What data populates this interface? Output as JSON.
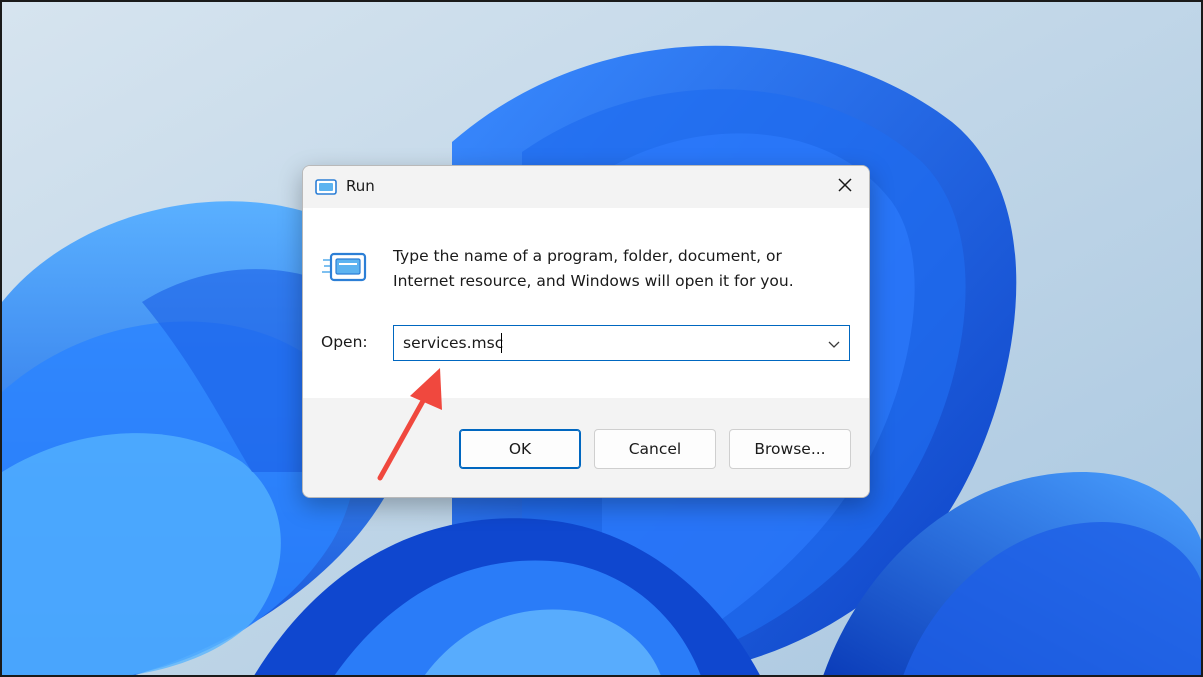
{
  "window": {
    "title": "Run",
    "title_icon": "run-icon",
    "close_icon": "close-icon"
  },
  "content": {
    "icon": "run-icon",
    "description_line1": "Type the name of a program, folder, document, or",
    "description_line2": "Internet resource, and Windows will open it for you.",
    "open_label": "Open:",
    "open_value": "services.msc",
    "dropdown_icon": "chevron-down-icon"
  },
  "buttons": {
    "ok": "OK",
    "cancel": "Cancel",
    "browse": "Browse..."
  },
  "colors": {
    "accent": "#0067c0",
    "annotation_arrow": "#f0483e",
    "wallpaper_blue": "#1a5fe0"
  }
}
